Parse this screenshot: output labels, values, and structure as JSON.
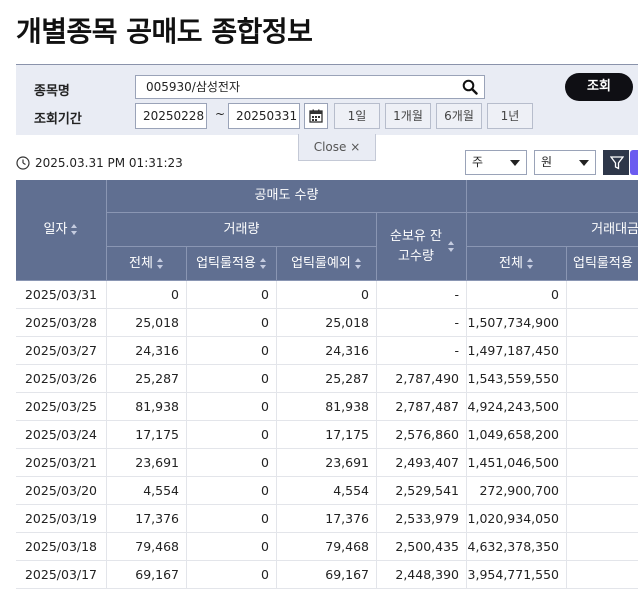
{
  "page_title": "개별종목 공매도 종합정보",
  "search": {
    "stock_label": "종목명",
    "stock_value": "005930/삼성전자",
    "period_label": "조회기간",
    "start_date": "20250228",
    "tilde": "~",
    "end_date": "20250331",
    "period_buttons": [
      "1일",
      "1개월",
      "6개월",
      "1년"
    ],
    "query_button": "조회",
    "close_tab": "Close ×"
  },
  "toolbar": {
    "timestamp": "2025.03.31 PM 01:31:23",
    "unit_select_1": "주",
    "unit_select_2": "원"
  },
  "table": {
    "col_date": "일자",
    "group_short_volume": "공매도 수량",
    "sub_trade_volume": "거래량",
    "col_total": "전체",
    "col_uptick_applied": "업틱룰적용",
    "col_uptick_exempt": "업틱룰예외",
    "col_net_balance": "순보유 잔고수량",
    "sub_trade_value": "거래대금",
    "col_value_total": "전체",
    "col_value_uptick_applied": "업틱룰적용",
    "rows": [
      {
        "date": "2025/03/31",
        "total": "0",
        "applied": "0",
        "exempt": "0",
        "balance": "-",
        "value_total": "0"
      },
      {
        "date": "2025/03/28",
        "total": "25,018",
        "applied": "0",
        "exempt": "25,018",
        "balance": "-",
        "value_total": "1,507,734,900"
      },
      {
        "date": "2025/03/27",
        "total": "24,316",
        "applied": "0",
        "exempt": "24,316",
        "balance": "-",
        "value_total": "1,497,187,450"
      },
      {
        "date": "2025/03/26",
        "total": "25,287",
        "applied": "0",
        "exempt": "25,287",
        "balance": "2,787,490",
        "value_total": "1,543,559,550"
      },
      {
        "date": "2025/03/25",
        "total": "81,938",
        "applied": "0",
        "exempt": "81,938",
        "balance": "2,787,487",
        "value_total": "4,924,243,500"
      },
      {
        "date": "2025/03/24",
        "total": "17,175",
        "applied": "0",
        "exempt": "17,175",
        "balance": "2,576,860",
        "value_total": "1,049,658,200"
      },
      {
        "date": "2025/03/21",
        "total": "23,691",
        "applied": "0",
        "exempt": "23,691",
        "balance": "2,493,407",
        "value_total": "1,451,046,500"
      },
      {
        "date": "2025/03/20",
        "total": "4,554",
        "applied": "0",
        "exempt": "4,554",
        "balance": "2,529,541",
        "value_total": "272,900,700"
      },
      {
        "date": "2025/03/19",
        "total": "17,376",
        "applied": "0",
        "exempt": "17,376",
        "balance": "2,533,979",
        "value_total": "1,020,934,050"
      },
      {
        "date": "2025/03/18",
        "total": "79,468",
        "applied": "0",
        "exempt": "79,468",
        "balance": "2,500,435",
        "value_total": "4,632,378,350"
      },
      {
        "date": "2025/03/17",
        "total": "69,167",
        "applied": "0",
        "exempt": "69,167",
        "balance": "2,448,390",
        "value_total": "3,954,771,550"
      }
    ]
  }
}
